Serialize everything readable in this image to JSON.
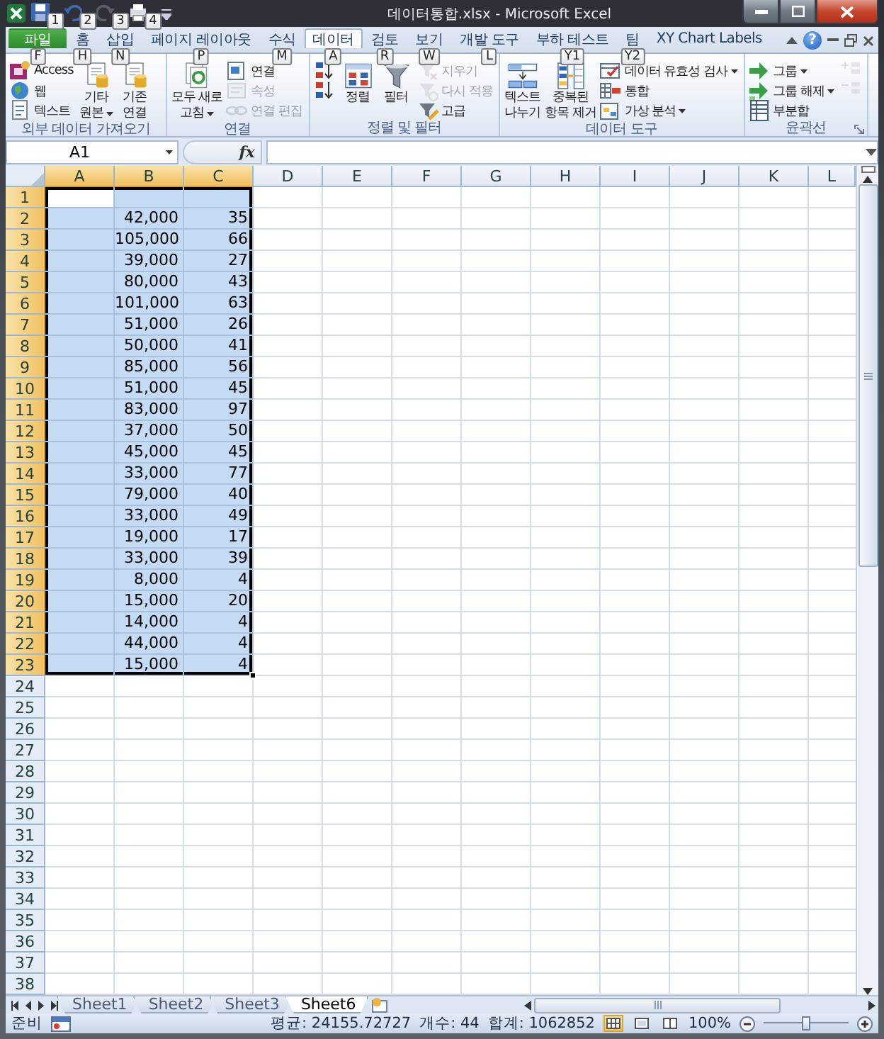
{
  "window": {
    "title": "데이터통합.xlsx - Microsoft Excel"
  },
  "quick_access": [
    {
      "keytip": "1",
      "disabled": false
    },
    {
      "keytip": "2",
      "disabled": false
    },
    {
      "keytip": "3",
      "disabled": true
    },
    {
      "keytip": "4",
      "disabled": false
    }
  ],
  "tabs": [
    {
      "label": "파일",
      "keytip": "F",
      "kind": "file",
      "selected": false
    },
    {
      "label": "홈",
      "keytip": "H",
      "kind": "tab",
      "selected": false
    },
    {
      "label": "삽입",
      "keytip": "N",
      "kind": "tab",
      "selected": false
    },
    {
      "label": "페이지 레이아웃",
      "keytip": "P",
      "kind": "tab",
      "selected": false
    },
    {
      "label": "수식",
      "keytip": "M",
      "kind": "tab",
      "selected": false
    },
    {
      "label": "데이터",
      "keytip": "A",
      "kind": "tab",
      "selected": true
    },
    {
      "label": "검토",
      "keytip": "R",
      "kind": "tab",
      "selected": false
    },
    {
      "label": "보기",
      "keytip": "W",
      "kind": "tab",
      "selected": false
    },
    {
      "label": "개발 도구",
      "keytip": "L",
      "kind": "tab",
      "selected": false
    },
    {
      "label": "부하 테스트",
      "keytip": "Y1",
      "kind": "tab",
      "selected": false
    },
    {
      "label": "팀",
      "keytip": "Y2",
      "kind": "tab",
      "selected": false
    },
    {
      "label": "XY Chart Labels",
      "kind": "tab",
      "selected": false
    }
  ],
  "help_button": "?",
  "ribbon": [
    {
      "label": "외부 데이터 가져오기",
      "items": [
        {
          "kind": "small",
          "label": "Access",
          "disabled": false
        },
        {
          "kind": "small",
          "label": "웹",
          "disabled": false
        },
        {
          "kind": "small",
          "label": "텍스트",
          "disabled": false
        },
        {
          "kind": "large",
          "lines": [
            "기타",
            "원본"
          ],
          "dropdown": true,
          "disabled": false
        },
        {
          "kind": "large",
          "lines": [
            "기존",
            "연결"
          ],
          "disabled": false
        }
      ]
    },
    {
      "label": "연결",
      "items": [
        {
          "kind": "large",
          "lines": [
            "모두 새로",
            "고침"
          ],
          "dropdown": true,
          "disabled": false
        },
        {
          "kind": "small",
          "label": "연결",
          "disabled": false
        },
        {
          "kind": "small",
          "label": "속성",
          "disabled": true
        },
        {
          "kind": "small",
          "label": "연결 편집",
          "disabled": true
        }
      ]
    },
    {
      "label": "정렬 및 필터",
      "items": [
        {
          "kind": "small",
          "disabled": false
        },
        {
          "kind": "small",
          "disabled": false
        },
        {
          "kind": "large",
          "lines": [
            "정렬"
          ],
          "disabled": false
        },
        {
          "kind": "large",
          "lines": [
            "필터"
          ],
          "disabled": false
        },
        {
          "kind": "small",
          "label": "지우기",
          "disabled": true
        },
        {
          "kind": "small",
          "label": "다시 적용",
          "disabled": true
        },
        {
          "kind": "small",
          "label": "고급",
          "disabled": false
        }
      ]
    },
    {
      "label": "데이터 도구",
      "items": [
        {
          "kind": "large",
          "lines": [
            "텍스트",
            "나누기"
          ],
          "disabled": false
        },
        {
          "kind": "large",
          "lines": [
            "중복된",
            "항목 제거"
          ],
          "disabled": false
        },
        {
          "kind": "small",
          "label": "데이터 유효성 검사",
          "dropdown": true,
          "disabled": false
        },
        {
          "kind": "small",
          "label": "통합",
          "disabled": false
        },
        {
          "kind": "small",
          "label": "가상 분석",
          "dropdown": true,
          "disabled": false
        }
      ]
    },
    {
      "label": "윤곽선",
      "launcher": true,
      "items": [
        {
          "kind": "small",
          "label": "그룹",
          "dropdown": true,
          "disabled": false
        },
        {
          "kind": "small",
          "label": "그룹 해제",
          "dropdown": true,
          "disabled": false
        },
        {
          "kind": "small",
          "label": "부분합",
          "disabled": false
        },
        {
          "kind": "small",
          "disabled": true
        },
        {
          "kind": "small",
          "disabled": true
        }
      ]
    }
  ],
  "formula_bar": {
    "name_box": "A1",
    "function_button": "fx"
  },
  "columns": [
    {
      "label": "A",
      "selected": true
    },
    {
      "label": "B",
      "selected": true
    },
    {
      "label": "C",
      "selected": true
    },
    {
      "label": "D",
      "selected": false
    },
    {
      "label": "E",
      "selected": false
    },
    {
      "label": "F",
      "selected": false
    },
    {
      "label": "G",
      "selected": false
    },
    {
      "label": "H",
      "selected": false
    },
    {
      "label": "I",
      "selected": false
    },
    {
      "label": "J",
      "selected": false
    },
    {
      "label": "K",
      "selected": false
    },
    {
      "label": "L",
      "selected": false
    }
  ],
  "rows": [
    {
      "number": "1",
      "selected": true,
      "cells": [
        {
          "active": true
        },
        {
          "active": false
        },
        {
          "active": false
        }
      ]
    },
    {
      "number": "2",
      "selected": true,
      "cells": [
        {
          "active": false
        },
        {
          "value": "42,000",
          "active": false
        },
        {
          "value": "35",
          "active": false
        }
      ]
    },
    {
      "number": "3",
      "selected": true,
      "cells": [
        {
          "active": false
        },
        {
          "value": "105,000",
          "active": false
        },
        {
          "value": "66",
          "active": false
        }
      ]
    },
    {
      "number": "4",
      "selected": true,
      "cells": [
        {
          "active": false
        },
        {
          "value": "39,000",
          "active": false
        },
        {
          "value": "27",
          "active": false
        }
      ]
    },
    {
      "number": "5",
      "selected": true,
      "cells": [
        {
          "active": false
        },
        {
          "value": "80,000",
          "active": false
        },
        {
          "value": "43",
          "active": false
        }
      ]
    },
    {
      "number": "6",
      "selected": true,
      "cells": [
        {
          "active": false
        },
        {
          "value": "101,000",
          "active": false
        },
        {
          "value": "63",
          "active": false
        }
      ]
    },
    {
      "number": "7",
      "selected": true,
      "cells": [
        {
          "active": false
        },
        {
          "value": "51,000",
          "active": false
        },
        {
          "value": "26",
          "active": false
        }
      ]
    },
    {
      "number": "8",
      "selected": true,
      "cells": [
        {
          "active": false
        },
        {
          "value": "50,000",
          "active": false
        },
        {
          "value": "41",
          "active": false
        }
      ]
    },
    {
      "number": "9",
      "selected": true,
      "cells": [
        {
          "active": false
        },
        {
          "value": "85,000",
          "active": false
        },
        {
          "value": "56",
          "active": false
        }
      ]
    },
    {
      "number": "10",
      "selected": true,
      "cells": [
        {
          "active": false
        },
        {
          "value": "51,000",
          "active": false
        },
        {
          "value": "45",
          "active": false
        }
      ]
    },
    {
      "number": "11",
      "selected": true,
      "cells": [
        {
          "active": false
        },
        {
          "value": "83,000",
          "active": false
        },
        {
          "value": "97",
          "active": false
        }
      ]
    },
    {
      "number": "12",
      "selected": true,
      "cells": [
        {
          "active": false
        },
        {
          "value": "37,000",
          "active": false
        },
        {
          "value": "50",
          "active": false
        }
      ]
    },
    {
      "number": "13",
      "selected": true,
      "cells": [
        {
          "active": false
        },
        {
          "value": "45,000",
          "active": false
        },
        {
          "value": "45",
          "active": false
        }
      ]
    },
    {
      "number": "14",
      "selected": true,
      "cells": [
        {
          "active": false
        },
        {
          "value": "33,000",
          "active": false
        },
        {
          "value": "77",
          "active": false
        }
      ]
    },
    {
      "number": "15",
      "selected": true,
      "cells": [
        {
          "active": false
        },
        {
          "value": "79,000",
          "active": false
        },
        {
          "value": "40",
          "active": false
        }
      ]
    },
    {
      "number": "16",
      "selected": true,
      "cells": [
        {
          "active": false
        },
        {
          "value": "33,000",
          "active": false
        },
        {
          "value": "49",
          "active": false
        }
      ]
    },
    {
      "number": "17",
      "selected": true,
      "cells": [
        {
          "active": false
        },
        {
          "value": "19,000",
          "active": false
        },
        {
          "value": "17",
          "active": false
        }
      ]
    },
    {
      "number": "18",
      "selected": true,
      "cells": [
        {
          "active": false
        },
        {
          "value": "33,000",
          "active": false
        },
        {
          "value": "39",
          "active": false
        }
      ]
    },
    {
      "number": "19",
      "selected": true,
      "cells": [
        {
          "active": false
        },
        {
          "value": "8,000",
          "active": false
        },
        {
          "value": "4",
          "active": false
        }
      ]
    },
    {
      "number": "20",
      "selected": true,
      "cells": [
        {
          "active": false
        },
        {
          "value": "15,000",
          "active": false
        },
        {
          "value": "20",
          "active": false
        }
      ]
    },
    {
      "number": "21",
      "selected": true,
      "cells": [
        {
          "active": false
        },
        {
          "value": "14,000",
          "active": false
        },
        {
          "value": "4",
          "active": false
        }
      ]
    },
    {
      "number": "22",
      "selected": true,
      "cells": [
        {
          "active": false
        },
        {
          "value": "44,000",
          "active": false
        },
        {
          "value": "4",
          "active": false
        }
      ]
    },
    {
      "number": "23",
      "selected": true,
      "cells": [
        {
          "active": false
        },
        {
          "value": "15,000",
          "active": false
        },
        {
          "value": "4",
          "active": false
        }
      ]
    },
    {
      "number": "24",
      "selected": false
    },
    {
      "number": "25",
      "selected": false
    },
    {
      "number": "26",
      "selected": false
    },
    {
      "number": "27",
      "selected": false
    },
    {
      "number": "28",
      "selected": false
    },
    {
      "number": "29",
      "selected": false
    },
    {
      "number": "30",
      "selected": false
    },
    {
      "number": "31",
      "selected": false
    },
    {
      "number": "32",
      "selected": false
    },
    {
      "number": "33",
      "selected": false
    },
    {
      "number": "34",
      "selected": false
    },
    {
      "number": "35",
      "selected": false
    },
    {
      "number": "36",
      "selected": false
    },
    {
      "number": "37",
      "selected": false
    },
    {
      "number": "38",
      "selected": false
    }
  ],
  "sheets": [
    {
      "label": "Sheet1",
      "selected": false
    },
    {
      "label": "Sheet2",
      "selected": false
    },
    {
      "label": "Sheet3",
      "selected": false
    },
    {
      "label": "Sheet6",
      "selected": true
    }
  ],
  "status_bar": {
    "mode": "준비",
    "stats": [
      "평균: 24155.72727",
      "개수: 44",
      "합계: 1062852"
    ],
    "views": [
      {
        "selected": true
      },
      {
        "selected": false
      },
      {
        "selected": false
      }
    ],
    "zoom": "100%",
    "zoom_slider": {
      "level": 0.5
    }
  }
}
